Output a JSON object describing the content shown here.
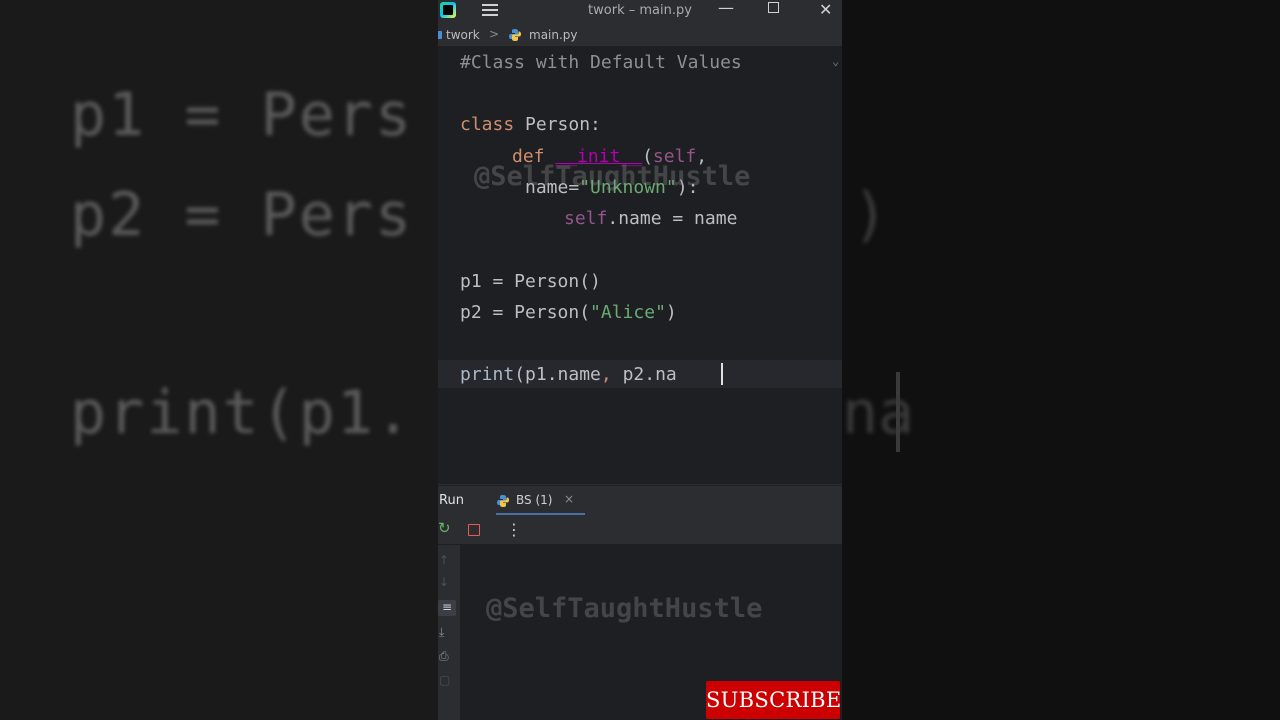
{
  "background": {
    "line1": "p1 = Pers",
    "line2": "p2 = Pers",
    "line2_tail": ")",
    "line3": "print(p1.",
    "line3_tail": "na"
  },
  "window": {
    "title": "twork – main.py",
    "menu_icon": "hamburger-menu-icon",
    "app_icon": "pycharm-icon"
  },
  "breadcrumb": {
    "project": "twork",
    "separator": ">",
    "file": "main.py"
  },
  "editor": {
    "comment": "#Class with Default Values",
    "class_kw": "class",
    "class_name": " Person:",
    "def_kw": "def",
    "init_name": "__init__",
    "init_open": "(",
    "self_param": "self",
    "init_comma": ",",
    "param_name": "name=",
    "param_default": "\"Unknown\"",
    "param_close": "):",
    "self_attr": "self",
    "assign": ".name = name",
    "p1_line": "p1 = Person()",
    "p2_prefix": "p2 = Person(",
    "p2_arg": "\"Alice\"",
    "p2_suffix": ")",
    "print_name": "print",
    "print_args1": "(p1.name",
    "print_comma": ",",
    "print_args2": " p2.na"
  },
  "watermark": "@SelfTaughtHustle",
  "run_panel": {
    "label": "Run",
    "tab_label": "BS (1)",
    "tab_close": "×",
    "more": "⋮"
  },
  "subscribe": "SUBSCRIBE",
  "colors": {
    "keyword": "#cf8e6d",
    "string": "#6aab73",
    "magic": "#b200b2",
    "self": "#94558d",
    "comment": "#8c8f94",
    "subscribe_bg": "#cc0000"
  }
}
